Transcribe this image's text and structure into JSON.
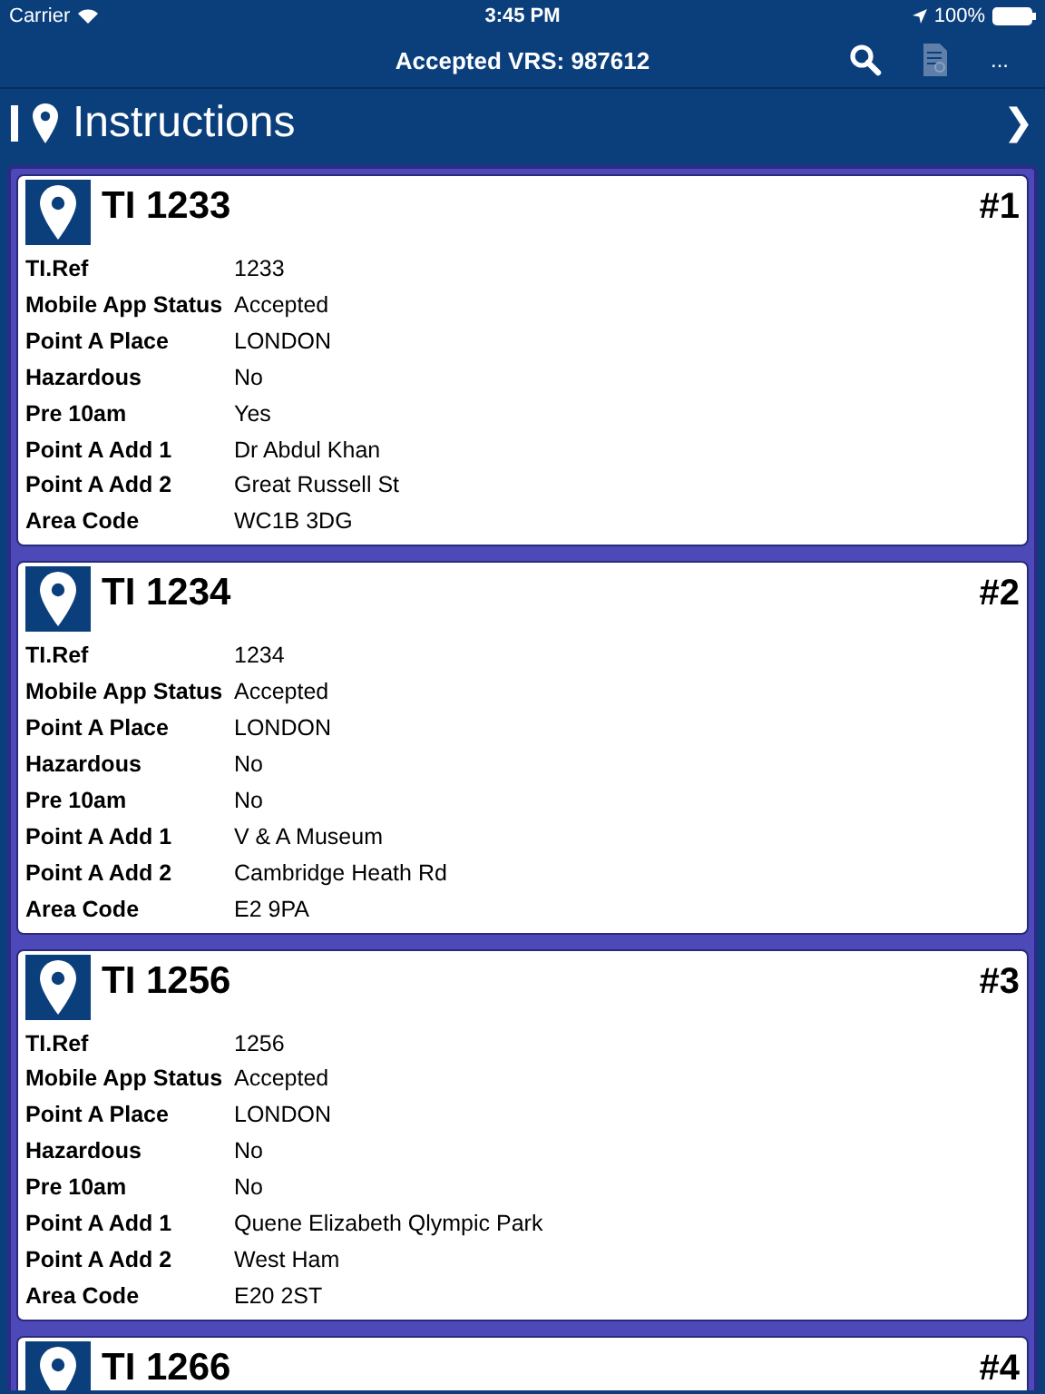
{
  "status_bar": {
    "carrier": "Carrier",
    "time": "3:45 PM",
    "battery": "100%"
  },
  "nav_bar": {
    "title": "Accepted VRS: 987612",
    "more": "..."
  },
  "section": {
    "title": "Instructions",
    "chevron": "❯"
  },
  "cards": [
    {
      "title": "TI 1233",
      "number": "#1",
      "rows": [
        {
          "label": "TI.Ref",
          "value": "1233"
        },
        {
          "label": "Mobile App Status",
          "value": "Accepted"
        },
        {
          "label": "Point A Place",
          "value": "LONDON"
        },
        {
          "label": "Hazardous",
          "value": "No"
        },
        {
          "label": "Pre 10am",
          "value": "Yes"
        },
        {
          "label": "Point A Add 1",
          "value": "Dr Abdul Khan"
        },
        {
          "label": "Point A Add 2",
          "value": "Great Russell St"
        },
        {
          "label": "Area Code",
          "value": "WC1B 3DG"
        }
      ]
    },
    {
      "title": "TI 1234",
      "number": "#2",
      "rows": [
        {
          "label": "TI.Ref",
          "value": "1234"
        },
        {
          "label": "Mobile App Status",
          "value": "Accepted"
        },
        {
          "label": "Point A Place",
          "value": "LONDON"
        },
        {
          "label": "Hazardous",
          "value": "No"
        },
        {
          "label": "Pre 10am",
          "value": "No"
        },
        {
          "label": "Point A Add 1",
          "value": "V & A Museum"
        },
        {
          "label": "Point A Add 2",
          "value": "Cambridge Heath Rd"
        },
        {
          "label": "Area Code",
          "value": "E2 9PA"
        }
      ]
    },
    {
      "title": "TI 1256",
      "number": "#3",
      "rows": [
        {
          "label": "TI.Ref",
          "value": "1256"
        },
        {
          "label": "Mobile App Status",
          "value": "Accepted"
        },
        {
          "label": "Point A Place",
          "value": "LONDON"
        },
        {
          "label": "Hazardous",
          "value": "No"
        },
        {
          "label": "Pre 10am",
          "value": "No"
        },
        {
          "label": "Point A Add 1",
          "value": "Quene Elizabeth Qlympic Park"
        },
        {
          "label": "Point A Add 2",
          "value": "West Ham"
        },
        {
          "label": "Area Code",
          "value": "E20 2ST"
        }
      ]
    },
    {
      "title": "TI 1266",
      "number": "#4"
    }
  ]
}
